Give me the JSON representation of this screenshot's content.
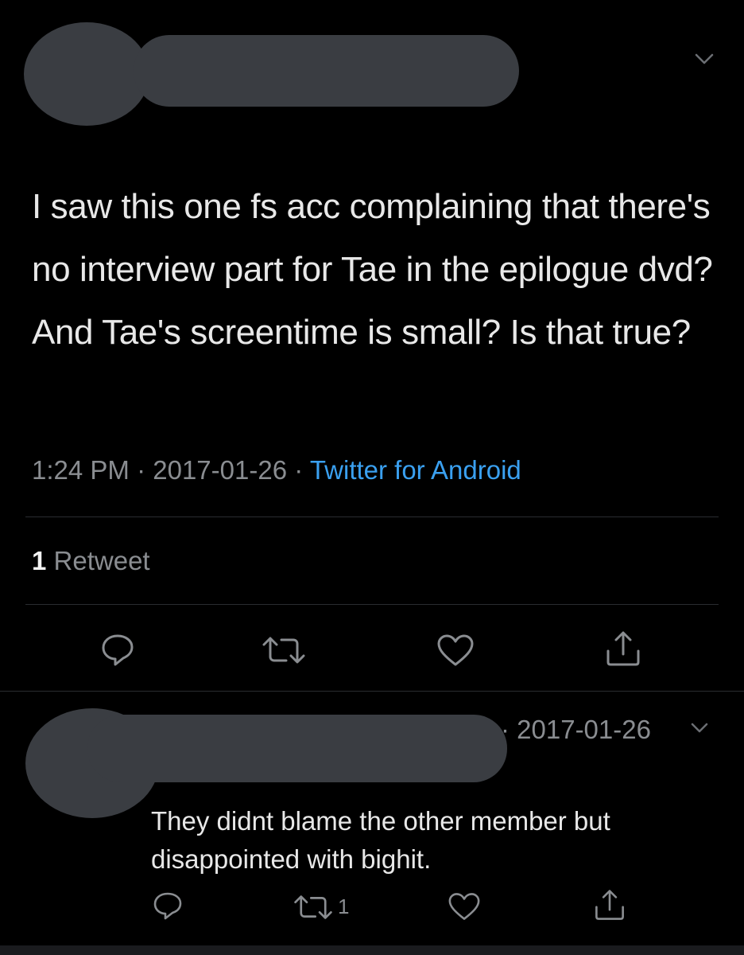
{
  "main_tweet": {
    "text": "I saw this one fs acc complaining that there's no interview part for Tae in the epilogue dvd? And Tae's screentime is small? Is that true?",
    "time": "1:24 PM",
    "separator": "·",
    "date": "2017-01-26",
    "source": "Twitter for Android",
    "retweet_count": "1",
    "retweet_label": "Retweet",
    "icons": [
      "reply-icon",
      "retweet-icon",
      "like-icon",
      "share-icon"
    ]
  },
  "reply_tweet": {
    "date": "· 2017-01-26",
    "text": "They didnt blame the other member but disappointed with bighit.",
    "retweet_count": "1",
    "icons": [
      "reply-icon",
      "retweet-icon",
      "like-icon",
      "share-icon"
    ]
  },
  "colors": {
    "background": "#000000",
    "text": "#e8e8e8",
    "muted": "#8a8d91",
    "link": "#3aa0f0",
    "redaction": "#3a3d42"
  }
}
